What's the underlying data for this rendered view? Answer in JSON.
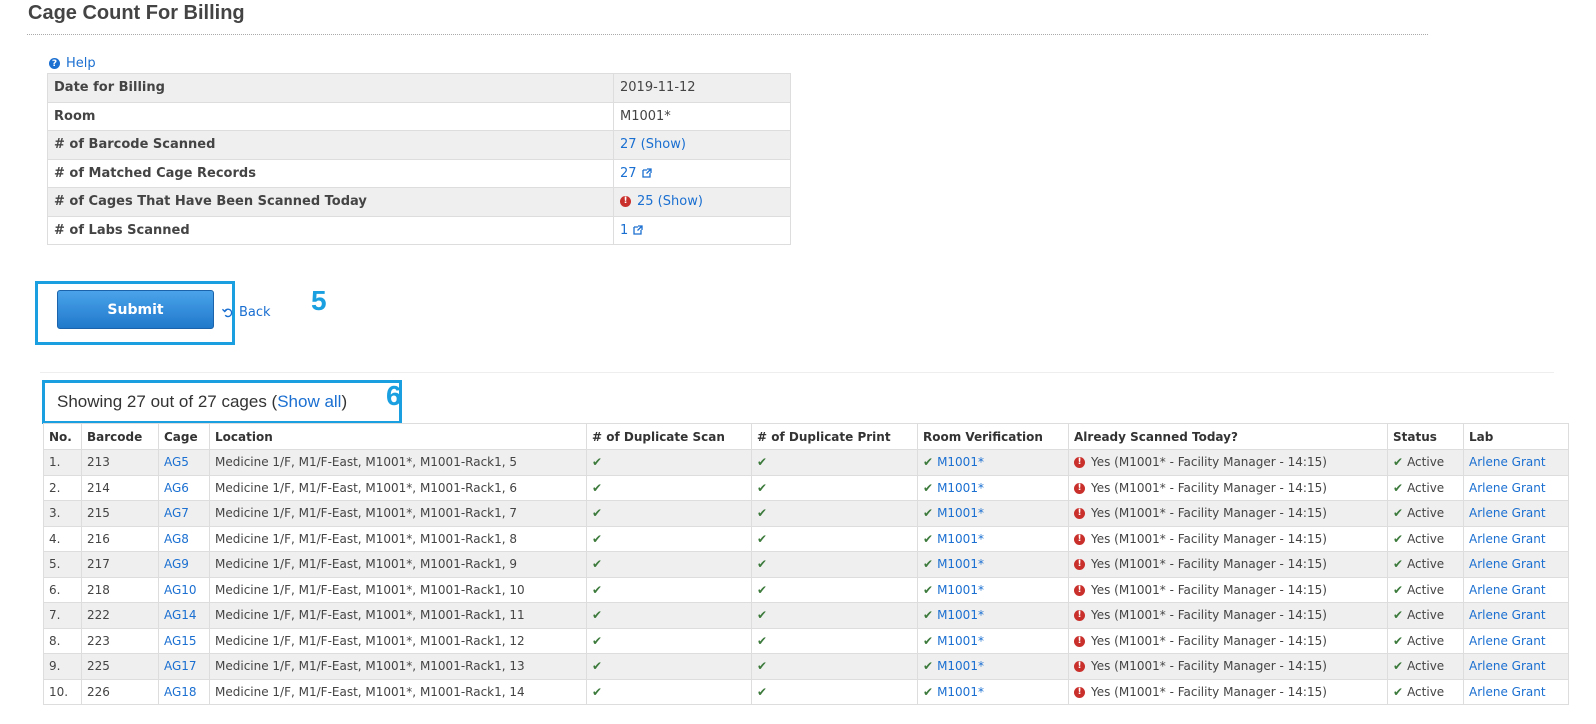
{
  "page": {
    "title": "Cage Count For Billing",
    "help_label": "Help"
  },
  "summary": {
    "rows": [
      {
        "label": "Date for Billing",
        "value": "2019-11-12"
      },
      {
        "label": "Room",
        "value": "M1001*"
      },
      {
        "label": "# of Barcode Scanned",
        "value": "27 (Show)"
      },
      {
        "label": "# of Matched Cage Records",
        "value": "27"
      },
      {
        "label": "# of Cages That Have Been Scanned Today",
        "value": "25 (Show)"
      },
      {
        "label": "# of Labs Scanned",
        "value": "1"
      }
    ]
  },
  "actions": {
    "submit_label": "Submit",
    "back_label": "Back",
    "annotation_5": "5",
    "annotation_6": "6"
  },
  "results": {
    "showing_prefix": "Showing 27 out of 27 cages (",
    "show_all_label": "Show all",
    "showing_suffix": ")"
  },
  "table": {
    "columns": [
      "No.",
      "Barcode",
      "Cage",
      "Location",
      "# of Duplicate Scan",
      "# of Duplicate Print",
      "Room Verification",
      "Already Scanned Today?",
      "Status",
      "Lab"
    ],
    "rows": [
      {
        "no": "1.",
        "barcode": "213",
        "cage": "AG5",
        "location": "Medicine 1/F, M1/F-East, M1001*, M1001-Rack1, 5",
        "room": "M1001*",
        "scanned": "Yes (M1001* - Facility Manager - 14:15)",
        "status": "Active",
        "lab": "Arlene Grant"
      },
      {
        "no": "2.",
        "barcode": "214",
        "cage": "AG6",
        "location": "Medicine 1/F, M1/F-East, M1001*, M1001-Rack1, 6",
        "room": "M1001*",
        "scanned": "Yes (M1001* - Facility Manager - 14:15)",
        "status": "Active",
        "lab": "Arlene Grant"
      },
      {
        "no": "3.",
        "barcode": "215",
        "cage": "AG7",
        "location": "Medicine 1/F, M1/F-East, M1001*, M1001-Rack1, 7",
        "room": "M1001*",
        "scanned": "Yes (M1001* - Facility Manager - 14:15)",
        "status": "Active",
        "lab": "Arlene Grant"
      },
      {
        "no": "4.",
        "barcode": "216",
        "cage": "AG8",
        "location": "Medicine 1/F, M1/F-East, M1001*, M1001-Rack1, 8",
        "room": "M1001*",
        "scanned": "Yes (M1001* - Facility Manager - 14:15)",
        "status": "Active",
        "lab": "Arlene Grant"
      },
      {
        "no": "5.",
        "barcode": "217",
        "cage": "AG9",
        "location": "Medicine 1/F, M1/F-East, M1001*, M1001-Rack1, 9",
        "room": "M1001*",
        "scanned": "Yes (M1001* - Facility Manager - 14:15)",
        "status": "Active",
        "lab": "Arlene Grant"
      },
      {
        "no": "6.",
        "barcode": "218",
        "cage": "AG10",
        "location": "Medicine 1/F, M1/F-East, M1001*, M1001-Rack1, 10",
        "room": "M1001*",
        "scanned": "Yes (M1001* - Facility Manager - 14:15)",
        "status": "Active",
        "lab": "Arlene Grant"
      },
      {
        "no": "7.",
        "barcode": "222",
        "cage": "AG14",
        "location": "Medicine 1/F, M1/F-East, M1001*, M1001-Rack1, 11",
        "room": "M1001*",
        "scanned": "Yes (M1001* - Facility Manager - 14:15)",
        "status": "Active",
        "lab": "Arlene Grant"
      },
      {
        "no": "8.",
        "barcode": "223",
        "cage": "AG15",
        "location": "Medicine 1/F, M1/F-East, M1001*, M1001-Rack1, 12",
        "room": "M1001*",
        "scanned": "Yes (M1001* - Facility Manager - 14:15)",
        "status": "Active",
        "lab": "Arlene Grant"
      },
      {
        "no": "9.",
        "barcode": "225",
        "cage": "AG17",
        "location": "Medicine 1/F, M1/F-East, M1001*, M1001-Rack1, 13",
        "room": "M1001*",
        "scanned": "Yes (M1001* - Facility Manager - 14:15)",
        "status": "Active",
        "lab": "Arlene Grant"
      },
      {
        "no": "10.",
        "barcode": "226",
        "cage": "AG18",
        "location": "Medicine 1/F, M1/F-East, M1001*, M1001-Rack1, 14",
        "room": "M1001*",
        "scanned": "Yes (M1001* - Facility Manager - 14:15)",
        "status": "Active",
        "lab": "Arlene Grant"
      }
    ]
  },
  "colors": {
    "link": "#1a6fd1",
    "annotation": "#1aa0e0",
    "check": "#3c7a3c",
    "error": "#c9302c"
  }
}
